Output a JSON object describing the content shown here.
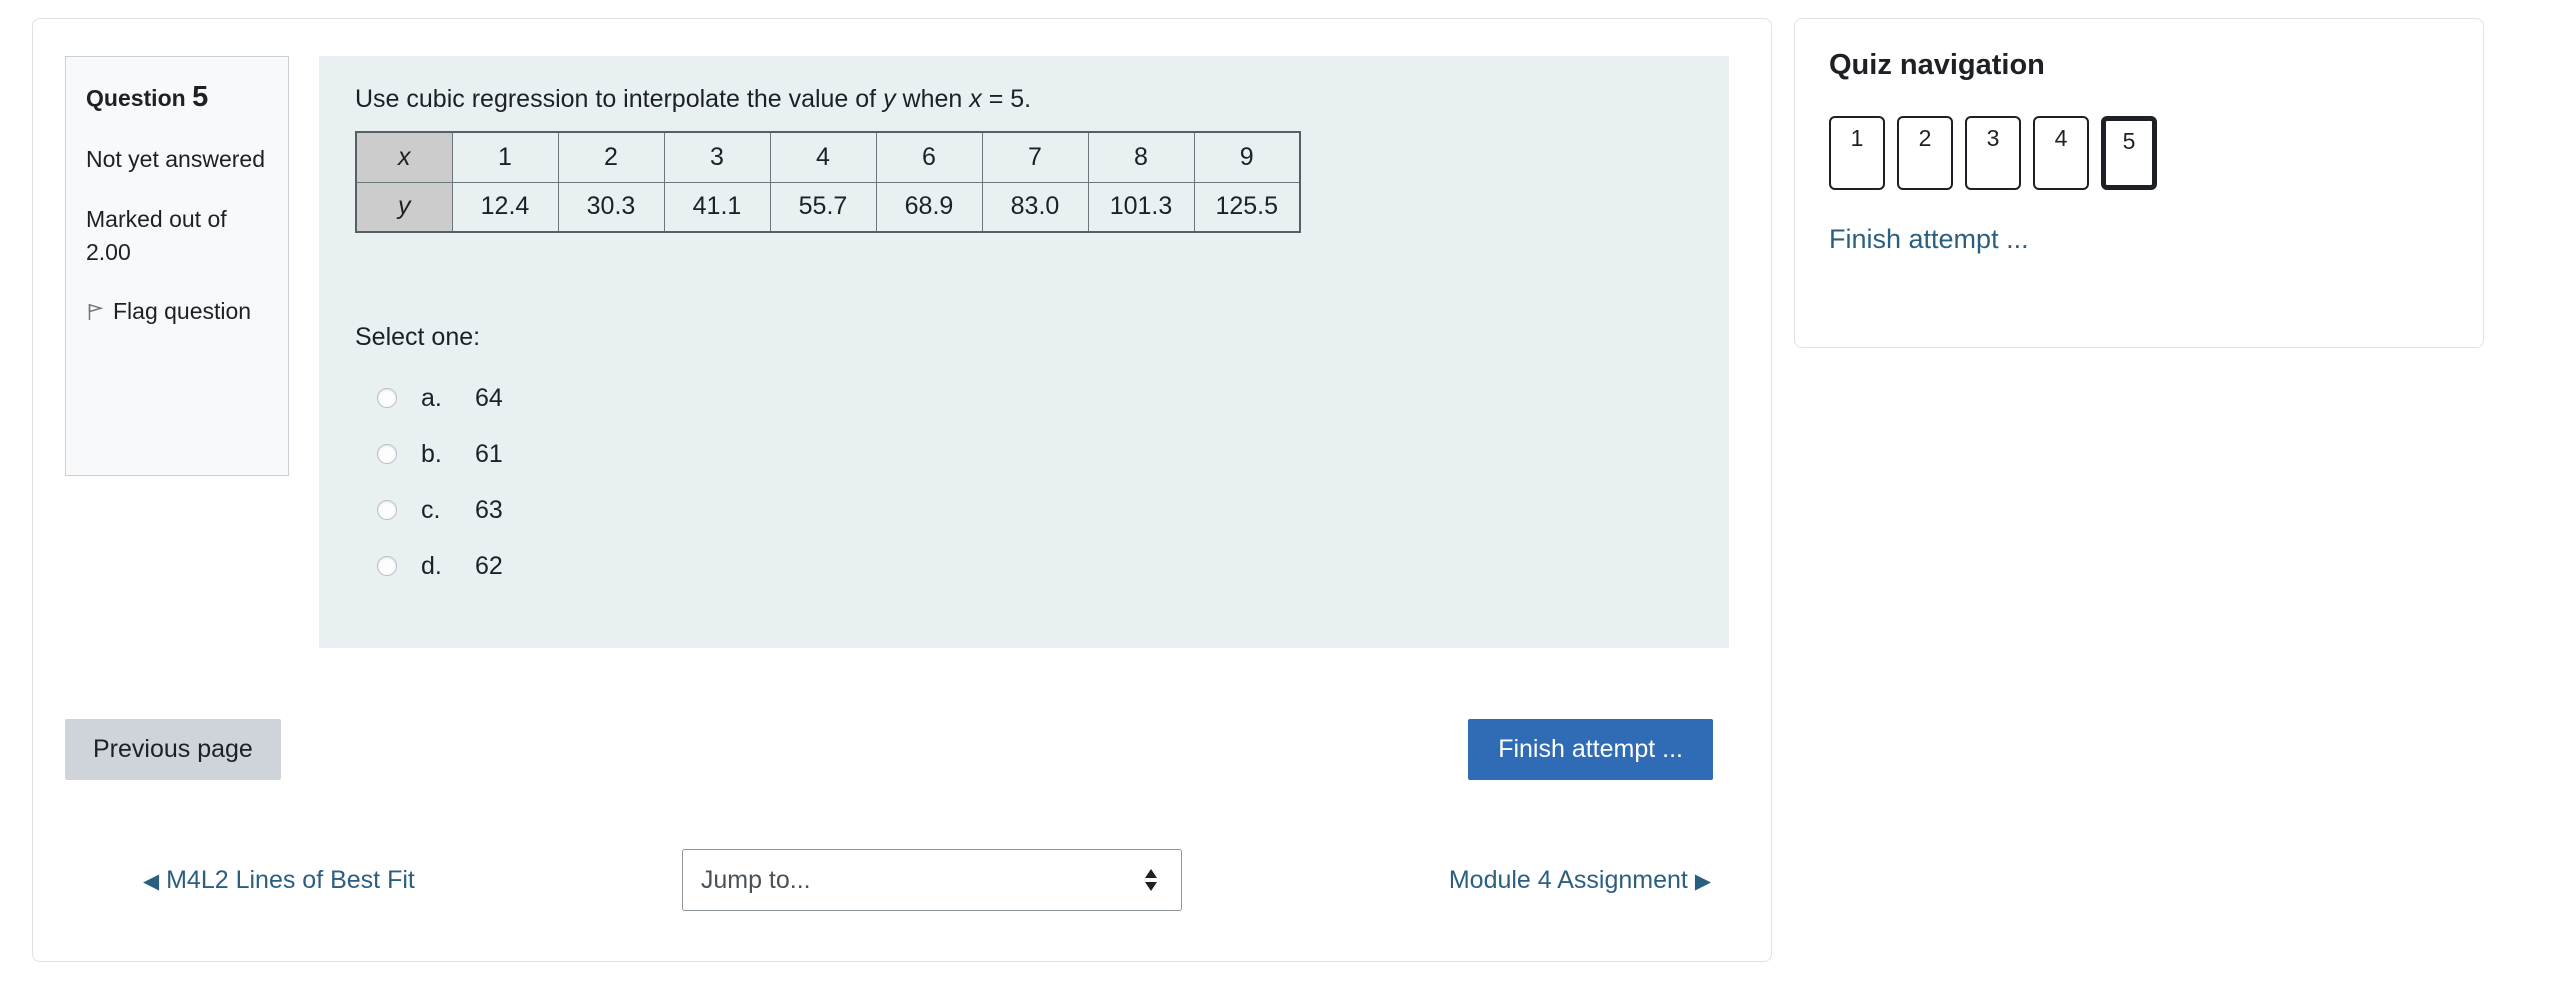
{
  "question": {
    "label": "Question",
    "number": "5",
    "state": "Not yet answered",
    "grade": "Marked out of 2.00",
    "flag_label": "Flag question",
    "text_before": "Use cubic regression to interpolate the value of ",
    "text_var_y": "y",
    "text_middle": " when ",
    "text_var_x": "x",
    "text_after": " = 5.",
    "select_prompt": "Select one:"
  },
  "data_table": {
    "row_x_label": "x",
    "row_y_label": "y",
    "x_values": [
      "1",
      "2",
      "3",
      "4",
      "6",
      "7",
      "8",
      "9"
    ],
    "y_values": [
      "12.4",
      "30.3",
      "41.1",
      "55.7",
      "68.9",
      "83.0",
      "101.3",
      "125.5"
    ]
  },
  "answers": [
    {
      "letter": "a.",
      "value": "64",
      "selected": false
    },
    {
      "letter": "b.",
      "value": "61",
      "selected": false
    },
    {
      "letter": "c.",
      "value": "63",
      "selected": false
    },
    {
      "letter": "d.",
      "value": "62",
      "selected": false
    }
  ],
  "buttons": {
    "previous_page": "Previous page",
    "finish_attempt": "Finish attempt ..."
  },
  "activity_nav": {
    "prev_arrow": "◀",
    "prev_label": "M4L2  Lines of Best Fit",
    "jump_placeholder": "Jump to...",
    "next_label": "Module 4 Assignment",
    "next_arrow": "▶"
  },
  "quiz_navigation": {
    "title": "Quiz navigation",
    "pages": [
      {
        "number": "1",
        "current": false
      },
      {
        "number": "2",
        "current": false
      },
      {
        "number": "3",
        "current": false
      },
      {
        "number": "4",
        "current": false
      },
      {
        "number": "5",
        "current": true
      }
    ],
    "finish_link": "Finish attempt ..."
  },
  "colors": {
    "question_body_bg": "#e8f0f2",
    "info_bg": "#f8f9fa",
    "table_header_bg": "#cccccc",
    "primary_button": "#2f6cb5",
    "secondary_button": "#ced4da",
    "link": "#2b5f82"
  }
}
